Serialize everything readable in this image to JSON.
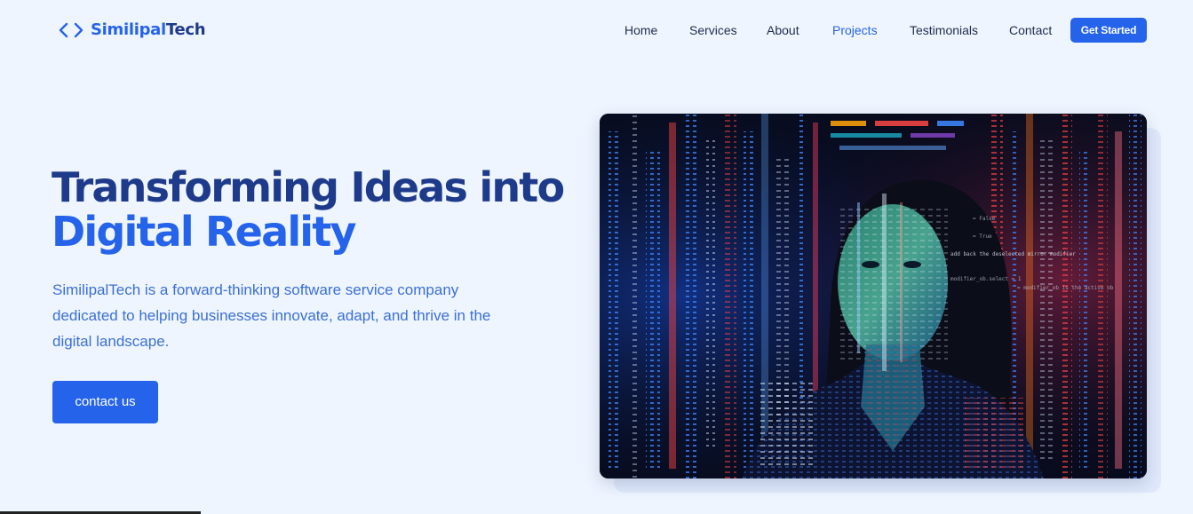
{
  "brand": {
    "name_part1": "Similipal",
    "name_part2": "Tech",
    "icon": "code-brackets-icon",
    "accent_color": "#2563eb",
    "dark_color": "#1e3a8a"
  },
  "nav": {
    "links": [
      {
        "label": "Home"
      },
      {
        "label": "Services"
      },
      {
        "label": "About"
      },
      {
        "label": "Projects",
        "active": true
      },
      {
        "label": "Testimonials"
      },
      {
        "label": "Contact"
      }
    ],
    "cta_label": "Get Started"
  },
  "hero": {
    "title_line1": "Transforming Ideas into",
    "title_line2": "Digital Reality",
    "description": "SimilipalTech is a forward-thinking software service company dedicated to helping businesses innovate, adapt, and thrive in the digital landscape.",
    "button_label": "contact us",
    "image_subject": "woman-with-projected-code-photo"
  },
  "image_text": {
    "code_line1": "add back the deselected mirror modifier",
    "code_line2": "modifier_ob.select = 1",
    "code_line3": "= modifier_ob is the active ob",
    "code_line4": "= False",
    "code_line5": "= True"
  }
}
